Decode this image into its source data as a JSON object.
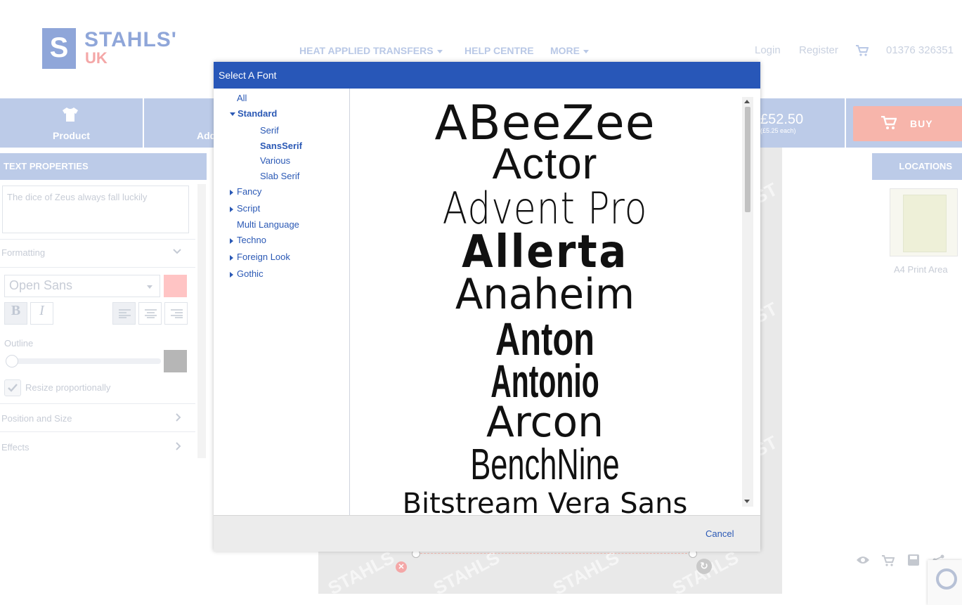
{
  "logo": {
    "letter": "S",
    "name": "STAHLS'",
    "sub": "UK"
  },
  "nav": {
    "items": [
      {
        "label": "HEAT APPLIED TRANSFERS",
        "has_dropdown": true
      },
      {
        "label": "HELP CENTRE",
        "has_dropdown": false
      },
      {
        "label": "MORE",
        "has_dropdown": true
      }
    ],
    "login": "Login",
    "register": "Register",
    "phone": "01376 326351"
  },
  "toolbar": {
    "product_label": "Product",
    "add_label": "Add",
    "price": "£52.50",
    "price_note": "(£5.25 each)",
    "buy_label": "BUY"
  },
  "left_panel": {
    "header": "TEXT PROPERTIES",
    "text_value": "The dice of Zeus always fall luckily",
    "formatting_label": "Formatting",
    "font_value": "Open Sans",
    "bold_label": "B",
    "italic_label": "I",
    "outline_label": "Outline",
    "resize_label": "Resize proportionally",
    "position_label": "Position and Size",
    "effects_label": "Effects"
  },
  "right_panel": {
    "header": "LOCATIONS",
    "location_label": "A4 Print Area"
  },
  "modal": {
    "title": "Select A Font",
    "categories": [
      {
        "label": "All",
        "level": 0,
        "toggle": "none",
        "selected": false
      },
      {
        "label": "Standard",
        "level": 0,
        "toggle": "down",
        "selected": true
      },
      {
        "label": "Serif",
        "level": 1,
        "toggle": "none",
        "selected": false
      },
      {
        "label": "SansSerif",
        "level": 1,
        "toggle": "none",
        "selected": true
      },
      {
        "label": "Various",
        "level": 1,
        "toggle": "none",
        "selected": false
      },
      {
        "label": "Slab Serif",
        "level": 1,
        "toggle": "none",
        "selected": false
      },
      {
        "label": "Fancy",
        "level": 0,
        "toggle": "right",
        "selected": false
      },
      {
        "label": "Script",
        "level": 0,
        "toggle": "right",
        "selected": false
      },
      {
        "label": "Multi Language",
        "level": 0,
        "toggle": "none",
        "selected": false
      },
      {
        "label": "Techno",
        "level": 0,
        "toggle": "right",
        "selected": false
      },
      {
        "label": "Foreign Look",
        "level": 0,
        "toggle": "right",
        "selected": false
      },
      {
        "label": "Gothic",
        "level": 0,
        "toggle": "right",
        "selected": false
      }
    ],
    "fonts": [
      "ABeeZee",
      "Actor",
      "Advent Pro",
      "Allerta",
      "Anaheim",
      "Anton",
      "Antonio",
      "Arcon",
      "BenchNine",
      "Bitstream Vera Sans"
    ],
    "cancel_label": "Cancel"
  },
  "colors": {
    "modal_header": "#2857b8",
    "link": "#2b59b5",
    "toolbar_dim": "#bccbe8",
    "buy_dim": "#f7b5ab",
    "color_swatch": "#ffc4c4",
    "outline_swatch": "#b6b6b6"
  }
}
